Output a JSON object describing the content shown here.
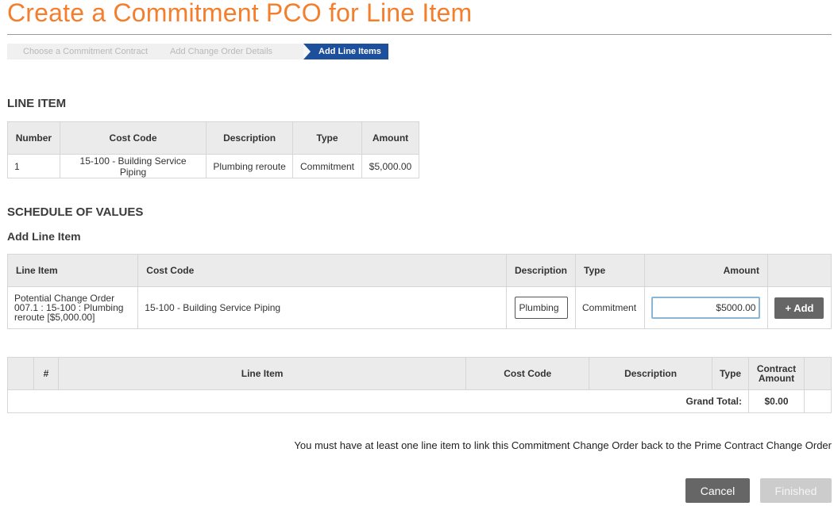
{
  "page": {
    "title": "Create a Commitment PCO for Line Item"
  },
  "steps": [
    {
      "label": "Choose a Commitment Contract",
      "active": false
    },
    {
      "label": "Add Change Order Details",
      "active": false
    },
    {
      "label": "Add Line Items",
      "active": true
    }
  ],
  "line_item": {
    "heading": "LINE ITEM",
    "headers": [
      "Number",
      "Cost Code",
      "Description",
      "Type",
      "Amount"
    ],
    "row": {
      "number": "1",
      "cost_code": "15-100 - Building Service Piping",
      "description": "Plumbing reroute",
      "type": "Commitment",
      "amount": "$5,000.00"
    }
  },
  "sov": {
    "heading": "SCHEDULE OF VALUES",
    "subheading": "Add Line Item",
    "headers": [
      "Line Item",
      "Cost Code",
      "Description",
      "Type",
      "Amount"
    ],
    "row": {
      "line_item": "Potential Change Order 007.1 : 15-100 : Plumbing reroute [$5,000.00]",
      "cost_code": "15-100 - Building Service Piping",
      "description_value": "Plumbing",
      "type": "Commitment",
      "amount_value": "$5000.00",
      "add_label": "+ Add"
    }
  },
  "totals": {
    "headers": [
      "#",
      "Line Item",
      "Cost Code",
      "Description",
      "Type",
      "Contract Amount"
    ],
    "grand_total_label": "Grand Total:",
    "grand_total_value": "$0.00"
  },
  "message": "You must have at least one line item to link this Commitment Change Order back to the Prime Contract Change Order",
  "buttons": {
    "cancel": "Cancel",
    "finished": "Finished"
  },
  "colors": {
    "title": "#f47e2b",
    "active_step": "#1c4f9c",
    "button_dark": "#666666",
    "button_disabled": "#cccccc"
  }
}
